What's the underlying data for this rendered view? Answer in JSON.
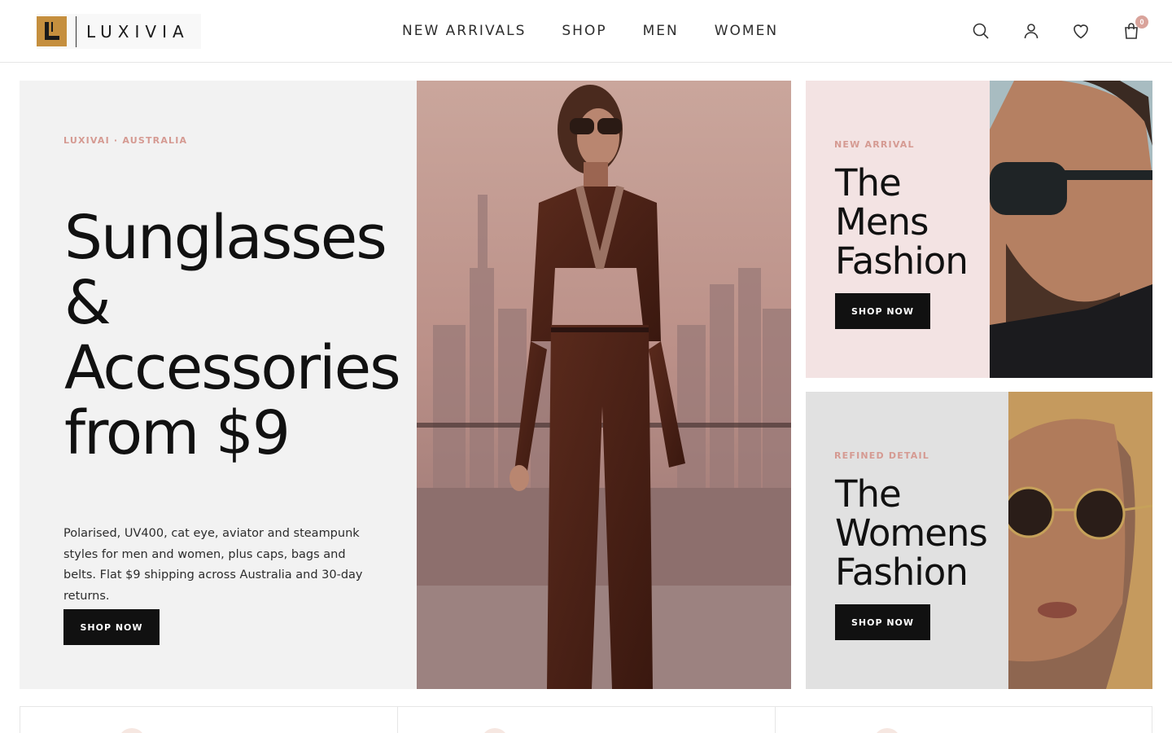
{
  "brand": {
    "name": "LUXIVIA"
  },
  "nav": {
    "items": [
      {
        "label": "NEW ARRIVALS"
      },
      {
        "label": "SHOP"
      },
      {
        "label": "MEN"
      },
      {
        "label": "WOMEN"
      }
    ]
  },
  "header_icons": {
    "search": "search-icon",
    "account": "user-icon",
    "wishlist": "heart-icon",
    "cart": "shopping-bag-icon",
    "cart_count": "0"
  },
  "hero": {
    "eyebrow": "LUXIVAI · AUSTRALIA",
    "title_lines": [
      "Sunglasses",
      "&",
      "Accessories",
      "from $9"
    ],
    "description": "Polarised, UV400, cat eye, aviator and steampunk styles for men and women, plus caps, bags and belts. Flat $9 shipping across Australia and 30-day returns.",
    "cta": "SHOP NOW"
  },
  "promo_men": {
    "eyebrow": "NEW ARRIVAL",
    "title_lines": [
      "The",
      "Mens",
      "Fashion"
    ],
    "cta": "SHOP NOW"
  },
  "promo_women": {
    "eyebrow": "REFINED DETAIL",
    "title_lines": [
      "The",
      "Womens",
      "Fashion"
    ],
    "cta": "SHOP NOW"
  },
  "colors": {
    "accent": "#d59a92",
    "logo_gold": "#c58f3e",
    "dark": "#111111",
    "hero_bg": "#f2f2f2",
    "men_bg": "#f3e3e3",
    "women_bg": "#e1e1e1"
  }
}
